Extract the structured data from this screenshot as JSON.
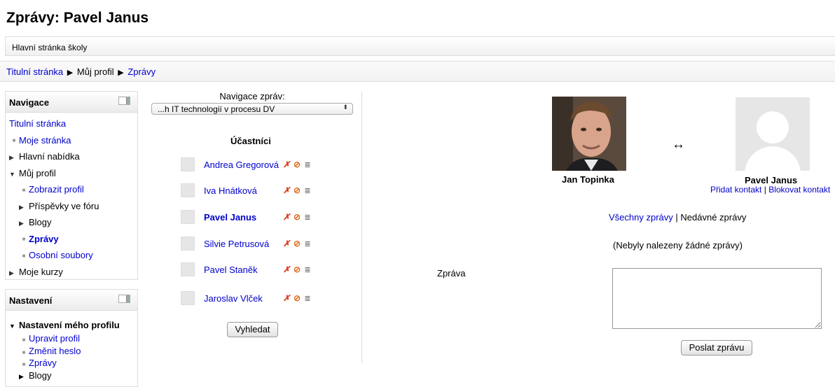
{
  "page": {
    "title": "Zprávy: Pavel Janus"
  },
  "topbar": {
    "label": "Hlavní stránka školy"
  },
  "breadcrumb": {
    "home": "Titulní stránka",
    "sep": "▶",
    "profile": "Můj profil",
    "current": "Zprávy"
  },
  "navigation": {
    "title": "Navigace",
    "items": [
      {
        "label": "Titulní stránka"
      },
      {
        "label": "Moje stránka"
      },
      {
        "label": "Hlavní nabídka"
      },
      {
        "label": "Můj profil"
      },
      {
        "label": "Zobrazit profil"
      },
      {
        "label": "Příspěvky ve fóru"
      },
      {
        "label": "Blogy"
      },
      {
        "label": "Zprávy"
      },
      {
        "label": "Osobní soubory"
      },
      {
        "label": "Moje kurzy"
      }
    ]
  },
  "settings": {
    "title": "Nastavení",
    "section": "Nastavení mého profilu",
    "items": [
      {
        "label": "Upravit profil"
      },
      {
        "label": "Změnit heslo"
      },
      {
        "label": "Zprávy"
      },
      {
        "label": "Blogy"
      }
    ]
  },
  "message_nav": {
    "label": "Navigace zpráv:",
    "selected": "...h IT technologií v procesu DV"
  },
  "participants": {
    "title": "Účastníci",
    "list": [
      {
        "name": "Andrea Gregorová"
      },
      {
        "name": "Iva Hnátková"
      },
      {
        "name": "Pavel Janus"
      },
      {
        "name": "Silvie Petrusová"
      },
      {
        "name": "Pavel Staněk"
      },
      {
        "name": "Jaroslav Vlček"
      }
    ],
    "search_button": "Vyhledat"
  },
  "conversation": {
    "me": "Jan Topinka",
    "other": "Pavel Janus",
    "add_contact": "Přidat kontakt",
    "block_contact": "Blokovat kontakt",
    "link_sep": "|",
    "all_messages": "Všechny zprávy",
    "recent_messages": "Nedávné zprávy",
    "no_messages": "(Nebyly nalezeny žádné zprávy)",
    "message_label": "Zpráva",
    "message_value": "",
    "send_button": "Poslat zprávu"
  },
  "icons": {
    "swap": "↔",
    "remove": "✗",
    "block": "⊘",
    "history": "≣"
  },
  "colors": {
    "link": "#0000cc",
    "remove_icon": "#e03a1a"
  }
}
